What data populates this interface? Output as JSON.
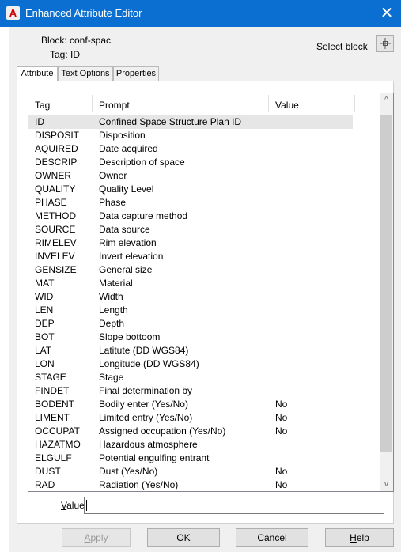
{
  "window": {
    "title": "Enhanced Attribute Editor",
    "close_symbol": "✕",
    "app_icon_letter": "A"
  },
  "header": {
    "block_label": "Block: conf-spac",
    "tag_label": "Tag: ID",
    "select_block_label": "Select block"
  },
  "tabs": [
    "Attribute",
    "Text Options",
    "Properties"
  ],
  "list": {
    "columns": [
      "Tag",
      "Prompt",
      "Value"
    ],
    "rows": [
      {
        "tag": "ID",
        "prompt": "Confined Space Structure Plan ID",
        "value": ""
      },
      {
        "tag": "DISPOSIT",
        "prompt": "Disposition",
        "value": ""
      },
      {
        "tag": "AQUIRED",
        "prompt": "Date acquired",
        "value": ""
      },
      {
        "tag": "DESCRIP",
        "prompt": "Description of space",
        "value": ""
      },
      {
        "tag": "OWNER",
        "prompt": "Owner",
        "value": ""
      },
      {
        "tag": "QUALITY",
        "prompt": "Quality Level",
        "value": ""
      },
      {
        "tag": "PHASE",
        "prompt": "Phase",
        "value": ""
      },
      {
        "tag": "METHOD",
        "prompt": "Data capture method",
        "value": ""
      },
      {
        "tag": "SOURCE",
        "prompt": "Data source",
        "value": ""
      },
      {
        "tag": "RIMELEV",
        "prompt": "Rim elevation",
        "value": ""
      },
      {
        "tag": "INVELEV",
        "prompt": "Invert elevation",
        "value": ""
      },
      {
        "tag": "GENSIZE",
        "prompt": "General size",
        "value": ""
      },
      {
        "tag": "MAT",
        "prompt": "Material",
        "value": ""
      },
      {
        "tag": "WID",
        "prompt": "Width",
        "value": ""
      },
      {
        "tag": "LEN",
        "prompt": "Length",
        "value": ""
      },
      {
        "tag": "DEP",
        "prompt": "Depth",
        "value": ""
      },
      {
        "tag": "BOT",
        "prompt": "Slope bottoom",
        "value": ""
      },
      {
        "tag": "LAT",
        "prompt": "Latitute (DD WGS84)",
        "value": ""
      },
      {
        "tag": "LON",
        "prompt": "Longitude (DD WGS84)",
        "value": ""
      },
      {
        "tag": "STAGE",
        "prompt": "Stage",
        "value": ""
      },
      {
        "tag": "FINDET",
        "prompt": "Final determination by",
        "value": ""
      },
      {
        "tag": "BODENT",
        "prompt": "Bodily enter (Yes/No)",
        "value": "No"
      },
      {
        "tag": "LIMENT",
        "prompt": "Limited entry (Yes/No)",
        "value": "No"
      },
      {
        "tag": "OCCUPAT",
        "prompt": "Assigned occupation (Yes/No)",
        "value": "No"
      },
      {
        "tag": "HAZATMO",
        "prompt": "Hazardous atmosphere",
        "value": ""
      },
      {
        "tag": "ELGULF",
        "prompt": "Potential engulfing entrant",
        "value": ""
      },
      {
        "tag": "DUST",
        "prompt": "Dust (Yes/No)",
        "value": "No"
      },
      {
        "tag": "RAD",
        "prompt": "Radiation (Yes/No)",
        "value": "No"
      }
    ],
    "scroll_up_symbol": "^",
    "scroll_down_symbol": "v"
  },
  "value_field": {
    "label": "Value:",
    "value": ""
  },
  "buttons": {
    "apply": "Apply",
    "ok": "OK",
    "cancel": "Cancel",
    "help": "Help"
  },
  "colors": {
    "titlebar": "#0a6fd1",
    "dialog_bg": "#f0f0f0"
  },
  "icons": {
    "app": "autocad-icon",
    "select": "crosshair-icon",
    "close": "close-icon"
  }
}
